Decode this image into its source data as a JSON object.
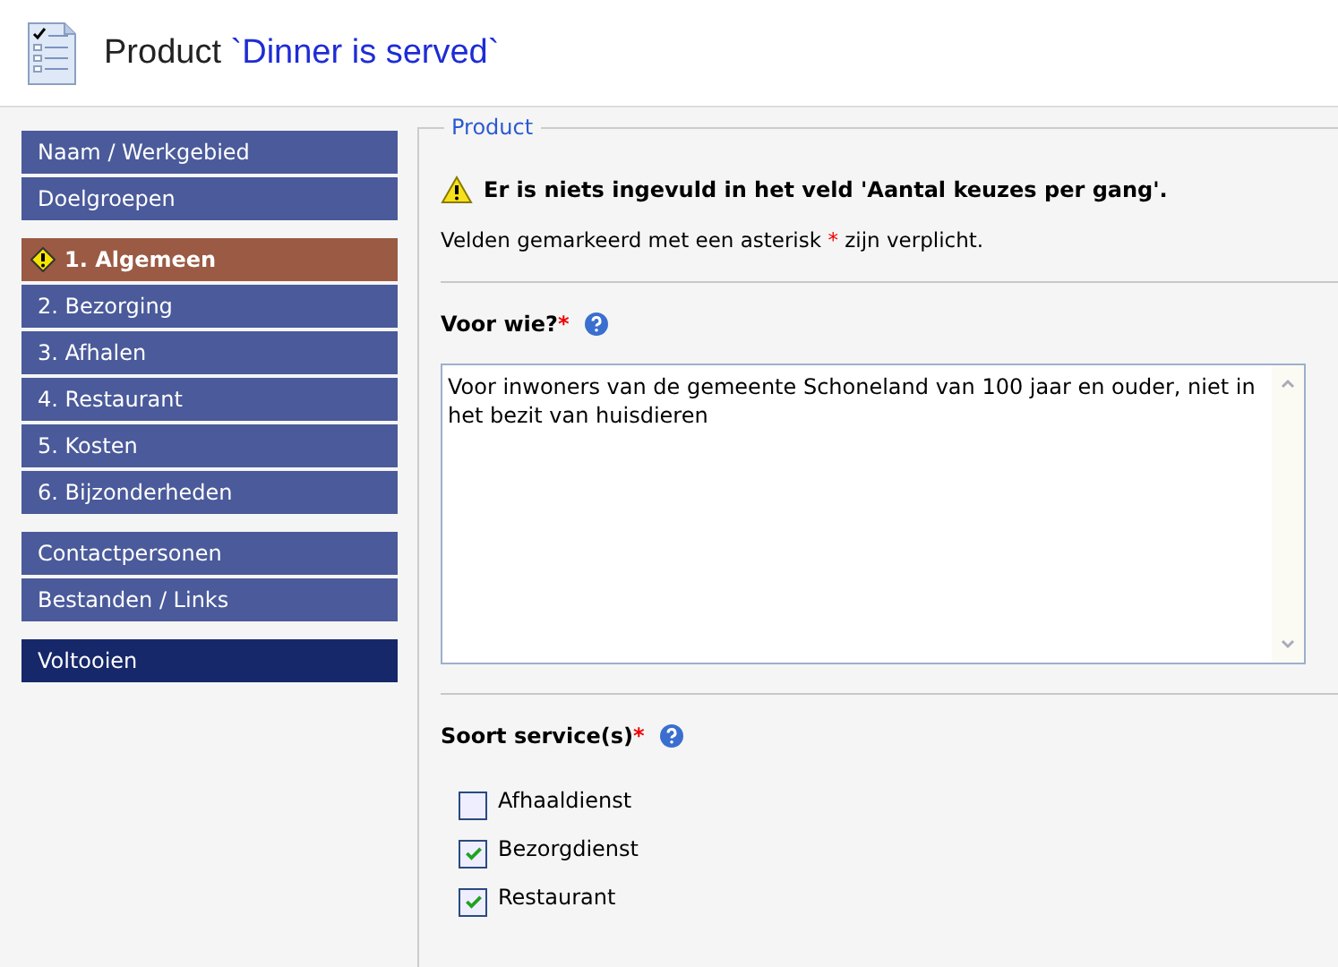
{
  "header": {
    "title_prefix": "Product",
    "title_name": "`Dinner is served`"
  },
  "sidebar": {
    "groups": [
      [
        {
          "label": "Naam / Werkgebied",
          "kind": "normal",
          "selected": false,
          "warning": false
        },
        {
          "label": "Doelgroepen",
          "kind": "normal",
          "selected": false,
          "warning": false
        }
      ],
      [
        {
          "label": "1. Algemeen",
          "kind": "normal",
          "selected": true,
          "warning": true
        },
        {
          "label": "2. Bezorging",
          "kind": "normal",
          "selected": false,
          "warning": false
        },
        {
          "label": "3. Afhalen",
          "kind": "normal",
          "selected": false,
          "warning": false
        },
        {
          "label": "4. Restaurant",
          "kind": "normal",
          "selected": false,
          "warning": false
        },
        {
          "label": "5. Kosten",
          "kind": "normal",
          "selected": false,
          "warning": false
        },
        {
          "label": "6. Bijzonderheden",
          "kind": "normal",
          "selected": false,
          "warning": false
        }
      ],
      [
        {
          "label": "Contactpersonen",
          "kind": "normal",
          "selected": false,
          "warning": false
        },
        {
          "label": "Bestanden / Links",
          "kind": "normal",
          "selected": false,
          "warning": false
        }
      ],
      [
        {
          "label": "Voltooien",
          "kind": "finish",
          "selected": false,
          "warning": false
        }
      ]
    ]
  },
  "form": {
    "legend": "Product",
    "error": "Er is niets ingevuld in het veld 'Aantal keuzes per gang'.",
    "note": {
      "before": "Velden gemarkeerd met een asterisk",
      "mark": "*",
      "after": "zijn verplicht."
    },
    "fields": [
      {
        "kind": "textarea",
        "label": "Voor wie?",
        "required_mark": "*",
        "value": "Voor inwoners van de gemeente Schoneland van 100 jaar en ouder, niet in het bezit van huisdieren"
      },
      {
        "kind": "checkboxes",
        "label": "Soort service(s)",
        "required_mark": "*",
        "options": [
          {
            "label": "Afhaaldienst",
            "checked": false
          },
          {
            "label": "Bezorgdienst",
            "checked": true
          },
          {
            "label": "Restaurant",
            "checked": true
          }
        ]
      }
    ]
  }
}
